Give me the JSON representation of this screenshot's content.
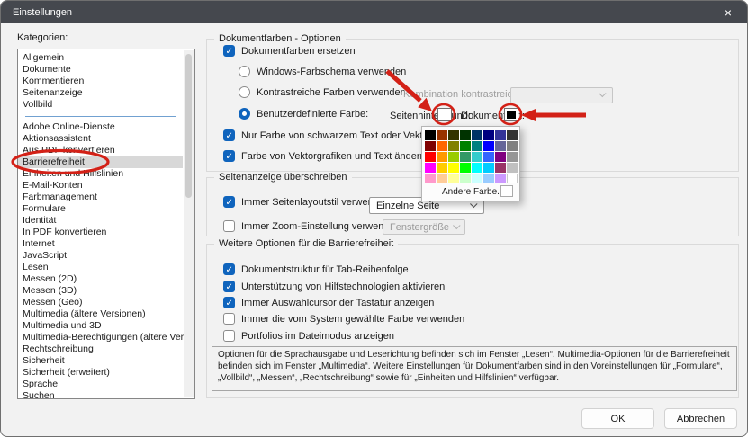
{
  "window": {
    "title": "Einstellungen",
    "close_label": "×"
  },
  "colors": {
    "accent": "#0f64bd",
    "titlebar": "#45484e",
    "annotation": "#d32117",
    "list_selection": "#d8d8d8",
    "separator_blue": "#71a1d1"
  },
  "sidebar": {
    "label": "Kategorien:",
    "separator_after_index": 4,
    "selected_index": 8,
    "items": [
      "Allgemein",
      "Dokumente",
      "Kommentieren",
      "Seitenanzeige",
      "Vollbild",
      "Adobe Online-Dienste",
      "Aktionsassistent",
      "Aus PDF konvertieren",
      "Barrierefreiheit",
      "Einheiten und Hilfslinien",
      "E-Mail-Konten",
      "Farbmanagement",
      "Formulare",
      "Identität",
      "In PDF konvertieren",
      "Internet",
      "JavaScript",
      "Lesen",
      "Messen (2D)",
      "Messen (3D)",
      "Messen (Geo)",
      "Multimedia (ältere Versionen)",
      "Multimedia und 3D",
      "Multimedia-Berechtigungen (ältere Versionen)",
      "Rechtschreibung",
      "Sicherheit",
      "Sicherheit (erweitert)",
      "Sprache",
      "Suchen"
    ]
  },
  "doc_colors": {
    "legend": "Dokumentfarben - Optionen",
    "replace_label": "Dokumentfarben ersetzen",
    "replace_checked": true,
    "windows_label": "Windows-Farbschema verwenden",
    "windows_selected": false,
    "contrast_label": "Kontrastreiche Farben verwenden",
    "contrast_selected": false,
    "contrast_combo_label": "Kombination kontrastreicher Farben:",
    "contrast_combo_value": "",
    "custom_label": "Benutzerdefinierte Farbe:",
    "custom_selected": true,
    "page_bg_label": "Seitenhintergrund:",
    "page_bg_color": "#FFFFFF",
    "doc_text_label": "Dokumenttext:",
    "doc_text_color": "#000000",
    "only_black_label": "Nur Farbe von schwarzem Text oder Vektorgrafiken ändern",
    "only_black_checked": true,
    "vector_label": "Farbe von Vektorgrafiken und Text ändern",
    "vector_checked": true
  },
  "page_display": {
    "legend": "Seitenanzeige überschreiben",
    "layout_label": "Immer Seitenlayoutstil verwenden",
    "layout_checked": true,
    "layout_value": "Einzelne Seite",
    "zoom_label": "Immer Zoom-Einstellung verwenden",
    "zoom_checked": false,
    "zoom_value": "Fenstergröße"
  },
  "accessibility": {
    "legend": "Weitere Optionen für die Barrierefreiheit",
    "options": [
      {
        "label": "Dokumentstruktur für Tab-Reihenfolge",
        "checked": true
      },
      {
        "label": "Unterstützung von Hilfstechnologien aktivieren",
        "checked": true
      },
      {
        "label": "Immer Auswahlcursor der Tastatur anzeigen",
        "checked": true
      },
      {
        "label": "Immer die vom System gewählte Farbe verwenden",
        "checked": false
      },
      {
        "label": "Portfolios im Dateimodus anzeigen",
        "checked": false
      }
    ],
    "info_text": "Optionen für die Sprachausgabe und Leserichtung befinden sich im Fenster „Lesen“. Multimedia-Optionen für die Barrierefreiheit befinden sich im Fenster „Multimedia“. Weitere Einstellungen für Dokumentfarben sind in den Voreinstellungen für „Formulare“, „Vollbild“, „Messen“, „Rechtschreibung“ sowie für „Einheiten und Hilfslinien“ verfügbar."
  },
  "color_popup": {
    "other_label": "Andere Farbe...",
    "custom_swatch_color": "#FFFFFF",
    "palette": [
      "#000000",
      "#993300",
      "#333300",
      "#003300",
      "#003366",
      "#000080",
      "#333399",
      "#333333",
      "#800000",
      "#FF6600",
      "#808000",
      "#008000",
      "#008080",
      "#0000FF",
      "#666699",
      "#808080",
      "#FF0000",
      "#FF9900",
      "#99CC00",
      "#339966",
      "#33CCCC",
      "#3366FF",
      "#800080",
      "#969696",
      "#FF00FF",
      "#FFCC00",
      "#FFFF00",
      "#00FF00",
      "#00FFFF",
      "#00CCFF",
      "#993366",
      "#C0C0C0",
      "#FF99CC",
      "#FFCC99",
      "#FFFF99",
      "#CCFFCC",
      "#CCFFFF",
      "#99CCFF",
      "#CC99FF",
      "#FFFFFF"
    ]
  },
  "buttons": {
    "ok": "OK",
    "cancel": "Abbrechen"
  }
}
